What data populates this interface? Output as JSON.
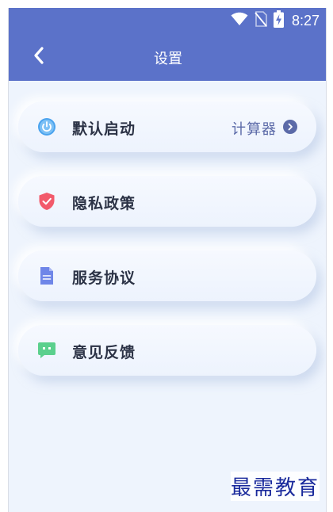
{
  "status_bar": {
    "time": "8:27",
    "icons": [
      "wifi-icon",
      "no-sim-icon",
      "battery-charging-icon"
    ]
  },
  "nav": {
    "title": "设置",
    "back_icon": "chevron-left-icon"
  },
  "menu": [
    {
      "label": "默认启动",
      "value": "计算器",
      "icon": "power-icon",
      "icon_color": "#4aa3ee"
    },
    {
      "label": "隐私政策",
      "icon": "shield-check-icon",
      "icon_color": "#f25a6b"
    },
    {
      "label": "服务协议",
      "icon": "document-icon",
      "icon_color": "#6f86e8"
    },
    {
      "label": "意见反馈",
      "icon": "chat-bubble-icon",
      "icon_color": "#5bd08d"
    }
  ],
  "watermark": "最需教育",
  "colors": {
    "app_bar": "#5b72c9",
    "background": "#eef4fd",
    "label_text": "#2c3346",
    "accent_text": "#5b6aa8"
  }
}
